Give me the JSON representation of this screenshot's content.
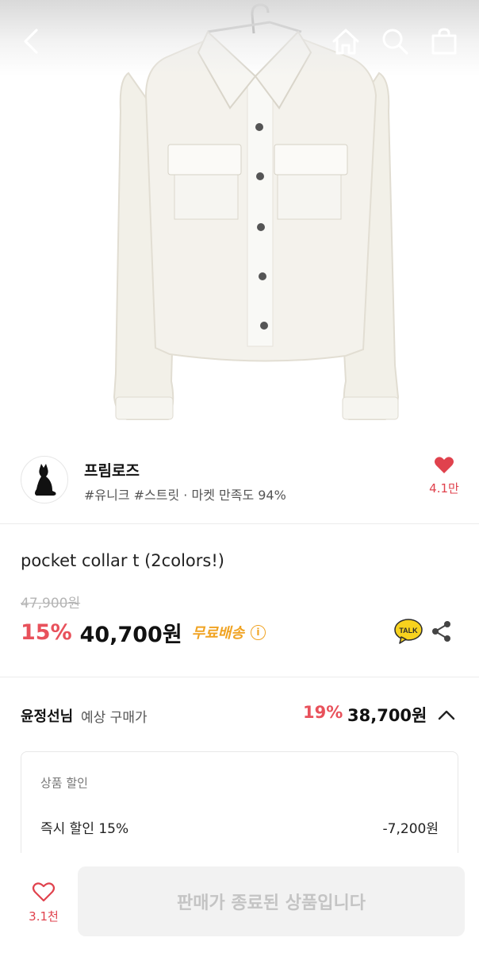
{
  "header": {
    "back_icon": "chevron-left-icon",
    "home_icon": "home-icon",
    "search_icon": "search-icon",
    "cart_icon": "shopping-bag-icon"
  },
  "product_image": {
    "subject": "cream long-sleeve button-up shirt with pocket collar on hanger",
    "icon": "product-photo"
  },
  "seller": {
    "name": "프림로즈",
    "tags": "#유니크 #스트릿 · 마켓 만족도 94%",
    "likes": "4.1만",
    "avatar_icon": "black-cat-icon"
  },
  "product": {
    "title": "pocket collar t (2colors!)",
    "original_price": "47,900원",
    "discount_rate": "15%",
    "sale_price": "40,700원",
    "shipping": "무료배송",
    "talk_label": "TALK"
  },
  "member_price": {
    "name": "윤정선님",
    "label": "예상 구매가",
    "discount_rate": "19%",
    "price": "38,700원"
  },
  "discount_box": {
    "title": "상품 할인",
    "item_label": "즉시 할인 15%",
    "item_amount": "-7,200원"
  },
  "bottom": {
    "wish_count": "3.1천",
    "soldout_label": "판매가 종료된 상품입니다"
  },
  "colors": {
    "accent_red": "#e8515b",
    "shipping_orange": "#f0a322",
    "kakao_yellow": "#f7d21e"
  }
}
